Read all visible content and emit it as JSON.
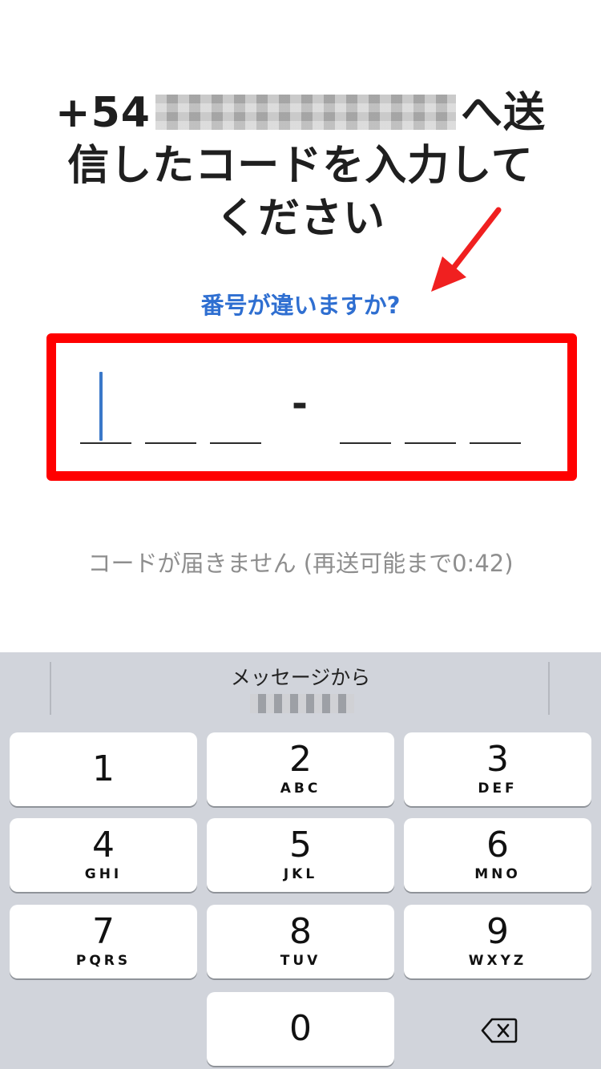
{
  "header": {
    "phone_prefix": "+54",
    "title_suffix_line1": "へ送",
    "title_line2": "信したコードを入力して",
    "title_line3": "ください"
  },
  "wrong_number_link": "番号が違いますか?",
  "code_entry": {
    "separator": "-",
    "slots_before": 3,
    "slots_after": 3
  },
  "resend_status": "コードが届きません (再送可能まで0:42)",
  "keyboard": {
    "suggestion_label": "メッセージから",
    "keys": [
      {
        "num": "1",
        "letters": ""
      },
      {
        "num": "2",
        "letters": "ABC"
      },
      {
        "num": "3",
        "letters": "DEF"
      },
      {
        "num": "4",
        "letters": "GHI"
      },
      {
        "num": "5",
        "letters": "JKL"
      },
      {
        "num": "6",
        "letters": "MNO"
      },
      {
        "num": "7",
        "letters": "PQRS"
      },
      {
        "num": "8",
        "letters": "TUV"
      },
      {
        "num": "9",
        "letters": "WXYZ"
      },
      {
        "num": "0",
        "letters": ""
      }
    ]
  },
  "colors": {
    "link": "#2f6fd1",
    "annotation_red": "#ff0000",
    "cursor": "#3a78c9",
    "keyboard_bg": "#d1d4db"
  },
  "icons": {
    "annotation": "red-arrow-icon",
    "delete": "backspace-icon"
  }
}
